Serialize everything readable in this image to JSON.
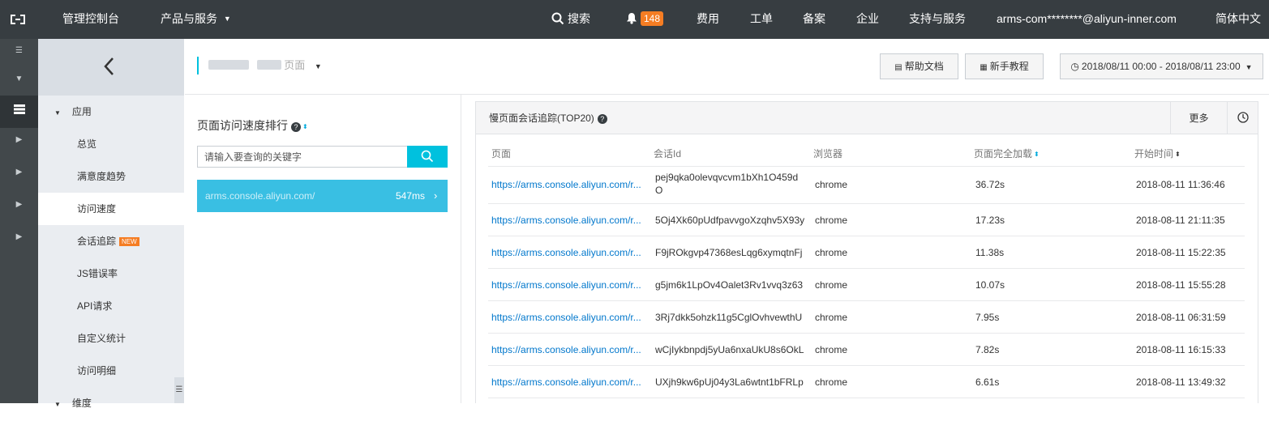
{
  "topbar": {
    "console": "管理控制台",
    "products": "产品与服务",
    "search": "搜索",
    "notif_count": "148",
    "fees": "费用",
    "tickets": "工单",
    "icp": "备案",
    "enterprise": "企业",
    "support": "支持与服务",
    "account": "arms-com********@aliyun-inner.com",
    "language": "简体中文"
  },
  "sidebar": {
    "group_app": "应用",
    "items": [
      "总览",
      "满意度趋势",
      "访问速度",
      "会话追踪",
      "JS错误率",
      "API请求",
      "自定义统计",
      "访问明细"
    ],
    "new_tag": "NEW",
    "group_dim": "维度"
  },
  "header": {
    "app_name_visible": "页面",
    "help_docs": "帮助文档",
    "tutorial": "新手教程",
    "time_range": "2018/08/11 00:00 - 2018/08/11 23:00"
  },
  "left_panel": {
    "title": "页面访问速度排行",
    "search_placeholder": "请输入要查询的关键字",
    "rank_item": {
      "url": "arms.console.aliyun.com/",
      "value": "547ms"
    }
  },
  "right_panel": {
    "title": "慢页面会话追踪(TOP20)",
    "more": "更多",
    "columns": [
      "页面",
      "会话Id",
      "浏览器",
      "页面完全加载",
      "开始时间"
    ],
    "rows": [
      {
        "page": "https://arms.console.aliyun.com/r...",
        "session": "pej9qka0olevqvcvm1bXh1O459dO",
        "browser": "chrome",
        "load": "36.72s",
        "start": "2018-08-11 11:36:46"
      },
      {
        "page": "https://arms.console.aliyun.com/r...",
        "session": "5Oj4Xk60pUdfpavvgoXzqhv5X93y",
        "browser": "chrome",
        "load": "17.23s",
        "start": "2018-08-11 21:11:35"
      },
      {
        "page": "https://arms.console.aliyun.com/r...",
        "session": "F9jROkgvp47368esLqg6xymqtnFj",
        "browser": "chrome",
        "load": "11.38s",
        "start": "2018-08-11 15:22:35"
      },
      {
        "page": "https://arms.console.aliyun.com/r...",
        "session": "g5jm6k1LpOv4Oalet3Rv1vvq3z63",
        "browser": "chrome",
        "load": "10.07s",
        "start": "2018-08-11 15:55:28"
      },
      {
        "page": "https://arms.console.aliyun.com/r...",
        "session": "3Rj7dkk5ohzk11g5CglOvhvewthU",
        "browser": "chrome",
        "load": "7.95s",
        "start": "2018-08-11 06:31:59"
      },
      {
        "page": "https://arms.console.aliyun.com/r...",
        "session": "wCjIykbnpdj5yUa6nxaUkU8s6OkL",
        "browser": "chrome",
        "load": "7.82s",
        "start": "2018-08-11 16:15:33"
      },
      {
        "page": "https://arms.console.aliyun.com/r...",
        "session": "UXjh9kw6pUj04y3La6wtnt1bFRLp",
        "browser": "chrome",
        "load": "6.61s",
        "start": "2018-08-11 13:49:32"
      }
    ]
  },
  "colors": {
    "accent": "#00c1de",
    "topbar": "#373d41",
    "badge": "#f57d23",
    "link": "#0077cc"
  }
}
